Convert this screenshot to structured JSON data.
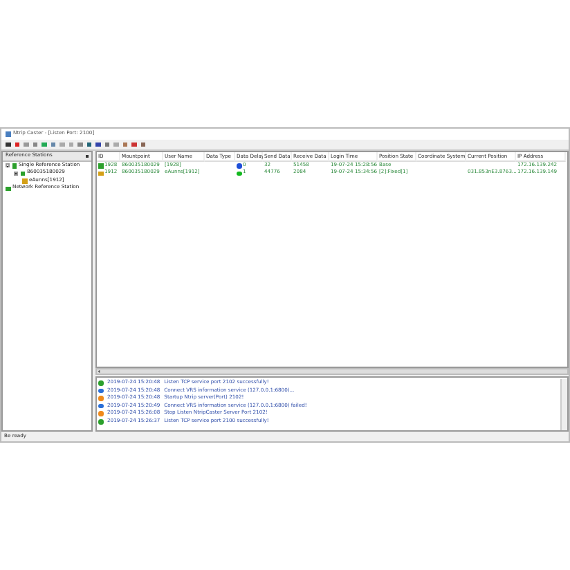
{
  "window": {
    "title": "Ntrip Caster - [Listen Port: 2100]"
  },
  "sidebar": {
    "title": "Reference Stations",
    "tree": [
      {
        "label": "Single Reference Station",
        "expanded": true,
        "children": [
          {
            "label": "860035180029",
            "expanded": true,
            "children": [
              {
                "label": "eAunns[1912]"
              }
            ]
          }
        ]
      },
      {
        "label": "Network Reference Station"
      }
    ]
  },
  "table": {
    "columns": [
      "ID",
      "Mountpoint",
      "User Name",
      "Data Type",
      "Data Delay",
      "Send Data",
      "Receive Data",
      "Login Time",
      "Position State",
      "Coordinate System",
      "Current Position",
      "IP Address"
    ],
    "rows": [
      {
        "cells": [
          "1928",
          "860035180029",
          "[1928]",
          "",
          "0",
          "32",
          "51458",
          "19-07-24 15:28:56",
          "Base",
          "",
          "",
          "172.16.139.242"
        ],
        "color": "#1e4fd8"
      },
      {
        "cells": [
          "1912",
          "860035180029",
          "eAunns[1912]",
          "",
          "1",
          "44776",
          "2084",
          "19-07-24 15:34:56",
          "[2]:Fixed[1]",
          "",
          "031.853nE3.8763...",
          "172.16.139.149"
        ],
        "color": "#12b81e"
      }
    ]
  },
  "log": [
    {
      "kind": "ok",
      "time": "2019-07-24 15:20:48",
      "message": "Listen TCP service port 2102 successfully!"
    },
    {
      "kind": "info",
      "time": "2019-07-24 15:20:48",
      "message": "Connect VRS information service (127.0.0.1:6800)..."
    },
    {
      "kind": "warn",
      "time": "2019-07-24 15:20:48",
      "message": "Startup Ntrip server(Port) 2102!"
    },
    {
      "kind": "info",
      "time": "2019-07-24 15:20:49",
      "message": "Connect VRS information service (127.0.0.1:6800) failed!"
    },
    {
      "kind": "warn",
      "time": "2019-07-24 15:26:08",
      "message": "Stop Listen NtripCaster Server Port 2102!"
    },
    {
      "kind": "ok",
      "time": "2019-07-24 15:26:37",
      "message": "Listen TCP service port 2100 successfully!"
    }
  ],
  "status_bar": "Be ready"
}
